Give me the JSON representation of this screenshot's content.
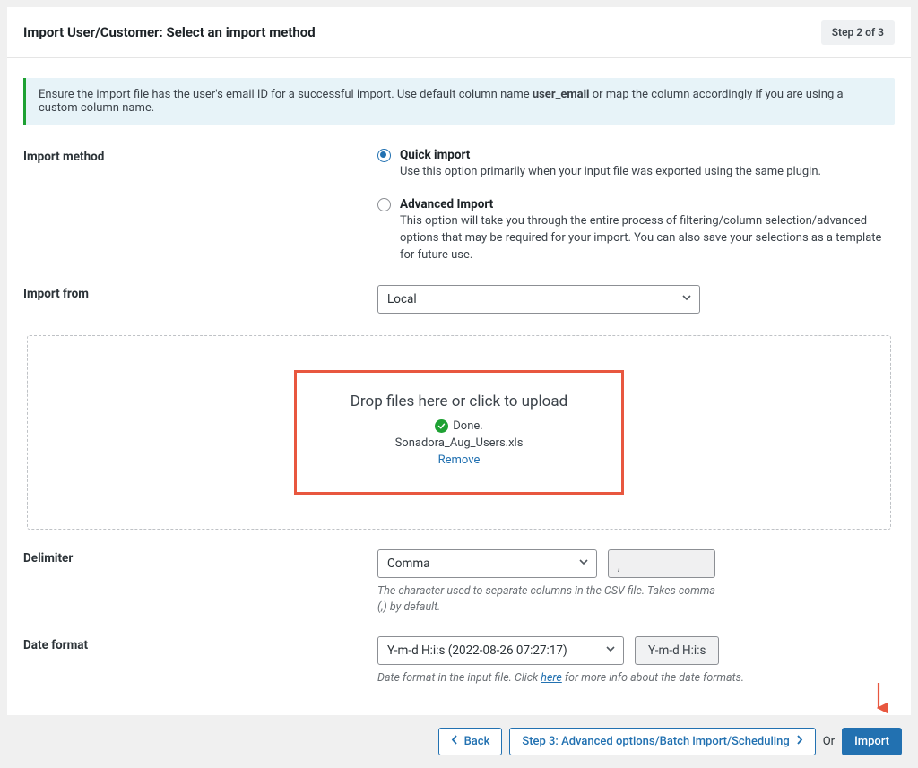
{
  "header": {
    "title": "Import User/Customer: Select an import method",
    "step_badge": "Step 2 of 3"
  },
  "notice": {
    "text_before": "Ensure the import file has the user's email ID for a successful import. Use default column name ",
    "bold": "user_email",
    "text_after": " or map the column accordingly if you are using a custom column name."
  },
  "import_method": {
    "label": "Import method",
    "quick": {
      "title": "Quick import",
      "desc": "Use this option primarily when your input file was exported using the same plugin."
    },
    "advanced": {
      "title": "Advanced Import",
      "desc": "This option will take you through the entire process of filtering/column selection/advanced options that may be required for your import. You can also save your selections as a template for future use."
    }
  },
  "import_from": {
    "label": "Import from",
    "value": "Local"
  },
  "dropzone": {
    "heading": "Drop files here or click to upload",
    "done": "Done.",
    "filename": "Sonadora_Aug_Users.xls",
    "remove": "Remove"
  },
  "delimiter": {
    "label": "Delimiter",
    "value": "Comma",
    "char": ",",
    "help": "The character used to separate columns in the CSV file. Takes comma (,) by default."
  },
  "date_format": {
    "label": "Date format",
    "value": "Y-m-d H:i:s (2022-08-26 07:27:17)",
    "code": "Y-m-d H:i:s",
    "help_before": "Date format in the input file. Click ",
    "help_link": "here",
    "help_after": " for more info about the date formats."
  },
  "footer": {
    "back": "Back",
    "step3": "Step 3: Advanced options/Batch import/Scheduling",
    "or": "Or",
    "import": "Import"
  }
}
